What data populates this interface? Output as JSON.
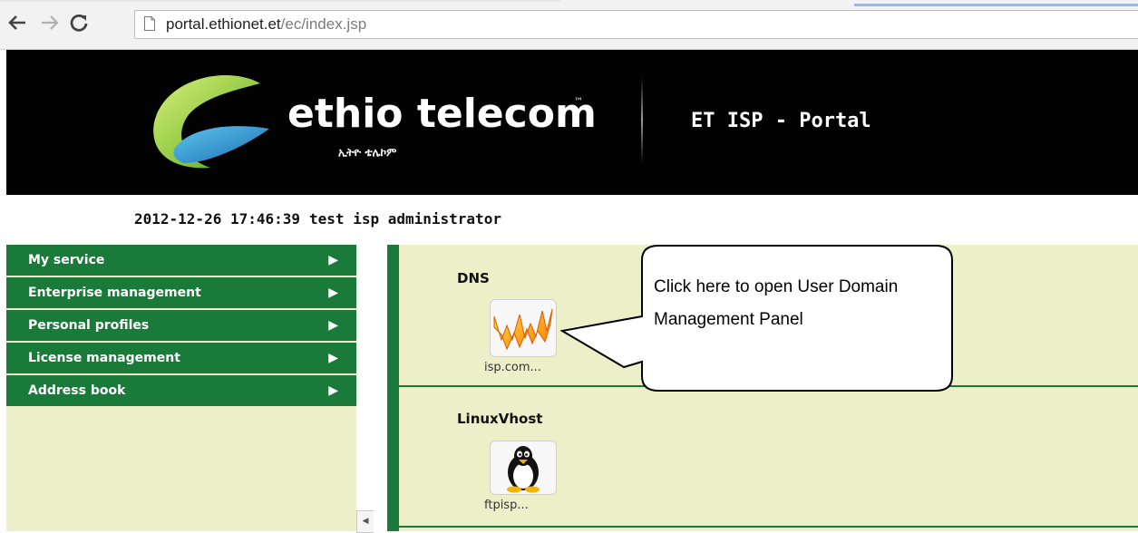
{
  "browser": {
    "back_icon": "back-arrow-icon",
    "forward_icon": "forward-arrow-icon",
    "reload_icon": "reload-icon",
    "page_icon": "page-icon",
    "url_host": "portal.ethionet.et",
    "url_path": "/ec/index.jsp"
  },
  "header": {
    "brand_name": "ethio telecom",
    "brand_tm": "™",
    "brand_amharic": "ኢትዮ ቴሌኮም",
    "portal_title": "ET ISP - Portal",
    "colors": {
      "background": "#020203",
      "logo_green": "#8cc63f",
      "logo_blue": "#1b8fc9"
    }
  },
  "info": {
    "datetime": "2012-12-26 17:46:39",
    "user": "test isp administrator"
  },
  "sidebar": {
    "items": [
      {
        "label": "My service"
      },
      {
        "label": "Enterprise management"
      },
      {
        "label": "Personal profiles"
      },
      {
        "label": "License management"
      },
      {
        "label": "Address book"
      }
    ],
    "arrow_glyph": "▶",
    "collapse_glyph": "◀"
  },
  "main": {
    "sections": [
      {
        "title": "DNS",
        "app_label": "isp.com...",
        "icon": "www-icon"
      },
      {
        "title": "LinuxVhost",
        "app_label": "ftpisp...",
        "icon": "tux-penguin-icon"
      }
    ]
  },
  "callout": {
    "text": "Click here to open User Domain Management Panel"
  },
  "colors": {
    "accent_green": "#1a7a3a",
    "panel_background": "#edefc9"
  }
}
